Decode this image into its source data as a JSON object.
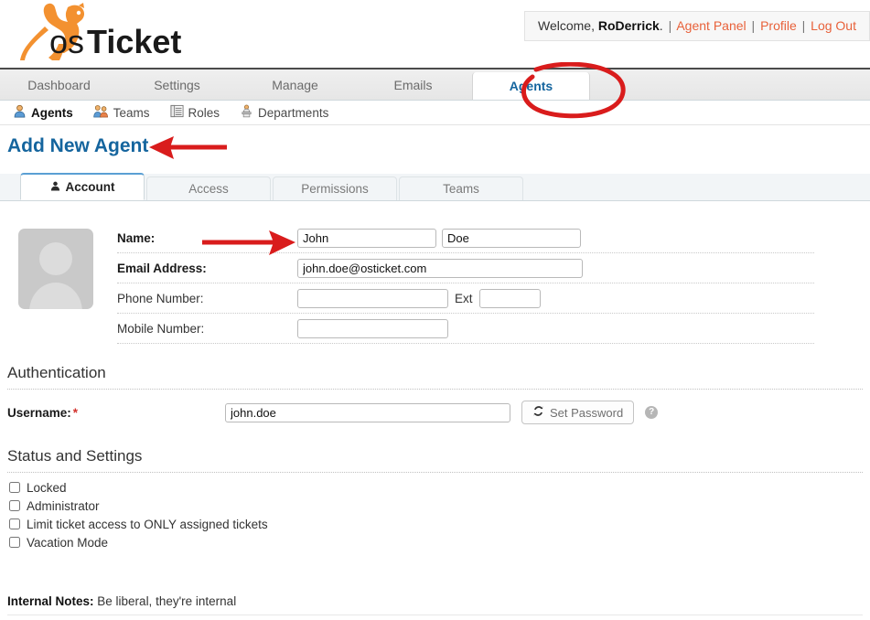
{
  "brand": {
    "name": "osTicket",
    "logo_prefix": "os",
    "logo_suffix": "Ticket",
    "logo_color": "#F39130",
    "accent_color": "#15659E",
    "link_color": "#E8613A",
    "annotation_color": "#D91C1C"
  },
  "header": {
    "welcome_text": "Welcome,",
    "username": "RoDerrick",
    "period": ".",
    "separator": "|",
    "links": [
      {
        "label": "Agent Panel",
        "name": "agent-panel-link"
      },
      {
        "label": "Profile",
        "name": "profile-link"
      },
      {
        "label": "Log Out",
        "name": "log-out-link"
      }
    ]
  },
  "topnav": {
    "items": [
      {
        "label": "Dashboard",
        "active": false
      },
      {
        "label": "Settings",
        "active": false
      },
      {
        "label": "Manage",
        "active": false
      },
      {
        "label": "Emails",
        "active": false
      },
      {
        "label": "Agents",
        "active": true
      }
    ]
  },
  "subnav": {
    "items": [
      {
        "label": "Agents",
        "icon": "agent-person-icon",
        "active": true
      },
      {
        "label": "Teams",
        "icon": "teams-people-icon",
        "active": false
      },
      {
        "label": "Roles",
        "icon": "roles-list-icon",
        "active": false
      },
      {
        "label": "Departments",
        "icon": "departments-podium-icon",
        "active": false
      }
    ]
  },
  "page": {
    "title": "Add New Agent"
  },
  "subtabs": {
    "items": [
      {
        "label": "Account",
        "icon": "person-icon",
        "active": true
      },
      {
        "label": "Access",
        "icon": "",
        "active": false
      },
      {
        "label": "Permissions",
        "icon": "",
        "active": false
      },
      {
        "label": "Teams",
        "icon": "",
        "active": false
      }
    ]
  },
  "account_form": {
    "avatar_alt": "agent-avatar-placeholder",
    "fields": {
      "name_label": "Name:",
      "first_name_value": "John",
      "last_name_value": "Doe",
      "email_label": "Email Address:",
      "email_value": "john.doe@osticket.com",
      "phone_label": "Phone Number:",
      "phone_value": "",
      "ext_label": "Ext",
      "ext_value": "",
      "mobile_label": "Mobile Number:",
      "mobile_value": ""
    }
  },
  "authentication": {
    "heading": "Authentication",
    "username_label": "Username:",
    "required_marker": "*",
    "username_value": "john.doe",
    "set_password_label": "Set Password",
    "set_password_icon": "refresh-icon",
    "help_icon_label": "?"
  },
  "status_settings": {
    "heading": "Status and Settings",
    "checkboxes": [
      {
        "label": "Locked",
        "checked": false
      },
      {
        "label": "Administrator",
        "checked": false
      },
      {
        "label": "Limit ticket access to ONLY assigned tickets",
        "checked": false
      },
      {
        "label": "Vacation Mode",
        "checked": false
      }
    ]
  },
  "internal_notes": {
    "label": "Internal Notes:",
    "hint": "Be liberal, they're internal"
  },
  "annotations": [
    {
      "type": "ellipse",
      "target": "Agents tab",
      "color": "#D91C1C"
    },
    {
      "type": "arrow-left",
      "target": "Add New Agent title",
      "color": "#D91C1C"
    },
    {
      "type": "arrow-right",
      "target": "Name first-name input",
      "color": "#D91C1C"
    }
  ]
}
